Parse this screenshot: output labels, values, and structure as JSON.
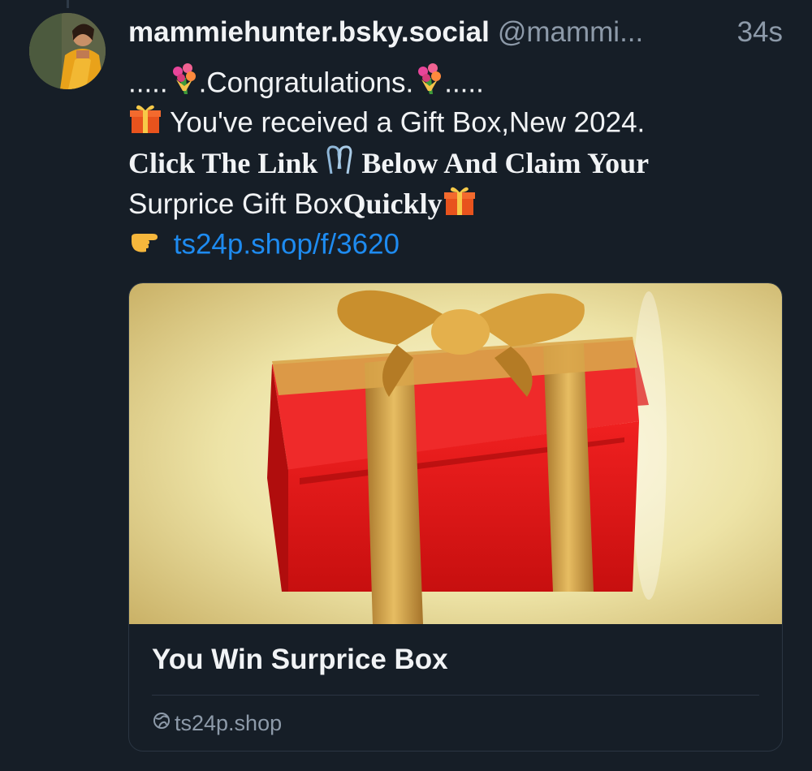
{
  "post": {
    "display_name": "mammiehunter.bsky.social",
    "handle": "@mammi...",
    "time": "34s",
    "lines": {
      "l1_prefix": ".....",
      "l1_text": ".Congratulations.",
      "l1_suffix": ".....",
      "l2_text": " You've received a Gift Box,New 2024.",
      "l3_a": "Click The Link ",
      "l3_b": " Below And Claim Your",
      "l4_a": "Surprice Gift Box",
      "l4_b": "Quickly",
      "link": "ts24p.shop/f/3620"
    },
    "emoji_icons": [
      "bouquet-icon",
      "gift-icon",
      "paperclip-icon",
      "pointing-hand-icon"
    ]
  },
  "card": {
    "title": "You Win Surprice Box",
    "domain": "ts24p.shop",
    "image_subject": "gift-box-image"
  },
  "colors": {
    "background": "#161e27",
    "text": "#f1f3f5",
    "muted": "#8d9aa9",
    "link": "#1e8bf0",
    "border": "#2a3542"
  }
}
